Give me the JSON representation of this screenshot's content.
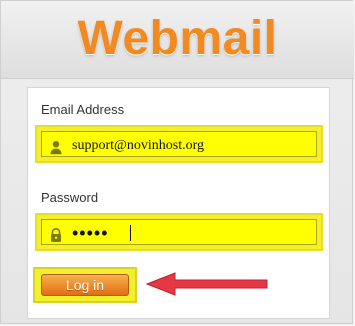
{
  "app": {
    "title": "Webmail"
  },
  "form": {
    "email": {
      "label": "Email Address",
      "value": "support@novinhost.org"
    },
    "password": {
      "label": "Password",
      "masked_value": "•••••"
    },
    "login_button_label": "Log in"
  },
  "icons": {
    "email_field_icon": "user-icon",
    "password_field_icon": "lock-icon",
    "annotation": "arrow-left-icon"
  },
  "colors": {
    "brand_orange": "#f28a22",
    "highlight_yellow": "#ffff00",
    "arrow_red": "#e53845"
  }
}
